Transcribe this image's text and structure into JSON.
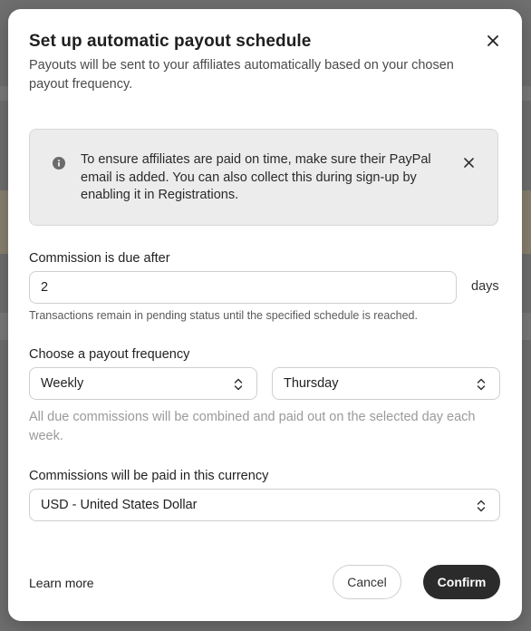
{
  "dialog": {
    "title": "Set up automatic payout schedule",
    "subtitle": "Payouts will be sent to your affiliates automatically based on your chosen payout frequency."
  },
  "notice": {
    "icon": "info-icon",
    "text": "To ensure affiliates are paid on time, make sure their PayPal email is added. You can also collect this during sign-up by enabling it in Registrations."
  },
  "commission_due": {
    "label": "Commission is due after",
    "value": "2",
    "unit": "days",
    "helper": "Transactions remain in pending status until the specified schedule is reached."
  },
  "payout_frequency": {
    "label": "Choose a payout frequency",
    "frequency": "Weekly",
    "day": "Thursday",
    "helper": "All due commissions will be combined and paid out on the selected day each week."
  },
  "currency": {
    "label": "Commissions will be paid in this currency",
    "value": "USD - United States Dollar"
  },
  "footer": {
    "learn_more": "Learn more",
    "cancel": "Cancel",
    "confirm": "Confirm"
  },
  "colors": {
    "primary_button": "#2b2b2b",
    "notice_background": "#ececec"
  }
}
